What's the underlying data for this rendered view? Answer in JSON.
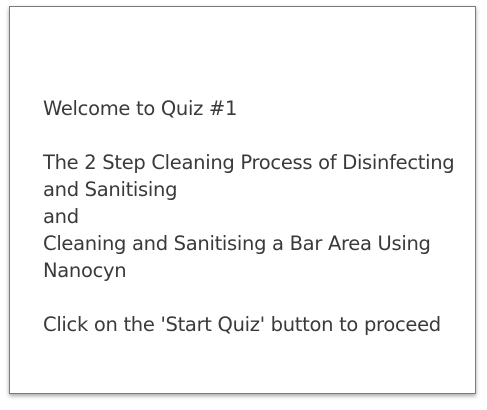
{
  "quiz_intro": {
    "welcome": "Welcome to Quiz #1",
    "topic_line_1": "The 2 Step Cleaning Process of Disinfecting",
    "topic_line_2": "and Sanitising",
    "connector": "and",
    "topic2_line_1": "Cleaning and Sanitising a Bar Area Using",
    "topic2_line_2": "Nanocyn",
    "instruction": "Click on the 'Start Quiz' button to proceed"
  },
  "colors": {
    "text": "#3a3a3a",
    "border": "#7a7a7a",
    "background": "#ffffff"
  }
}
